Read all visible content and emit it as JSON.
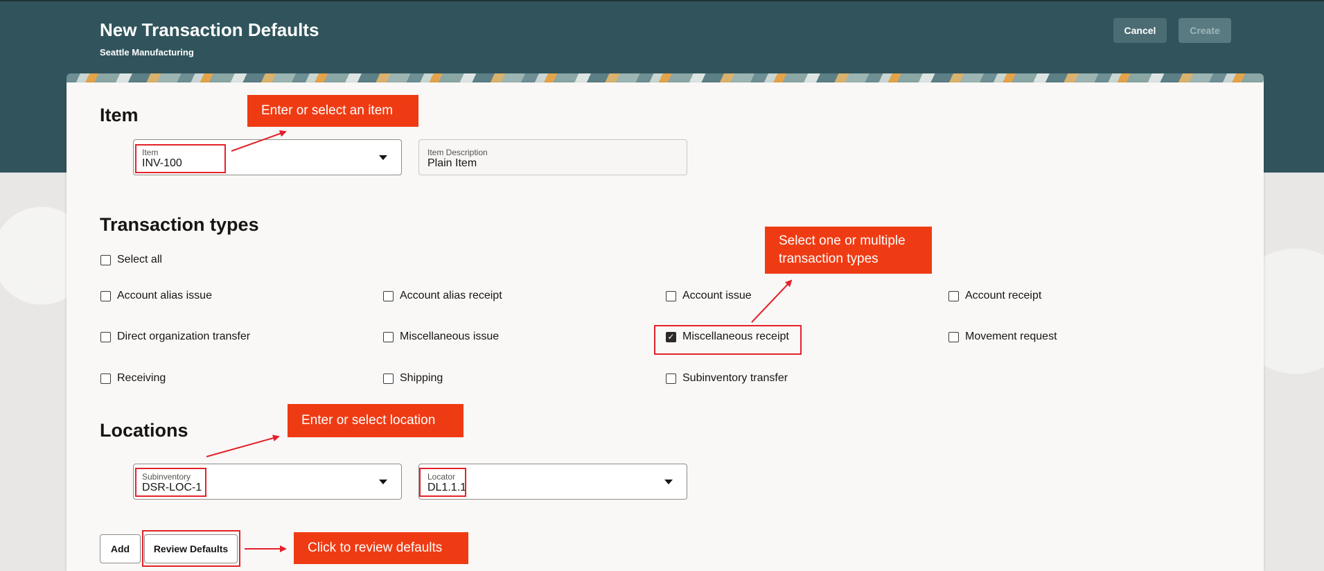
{
  "header": {
    "title": "New Transaction Defaults",
    "subtitle": "Seattle Manufacturing",
    "cancel_label": "Cancel",
    "create_label": "Create"
  },
  "item_section": {
    "title": "Item",
    "item_field": {
      "label": "Item",
      "value": "INV-100"
    },
    "description_field": {
      "label": "Item Description",
      "value": "Plain Item"
    }
  },
  "transaction_types": {
    "title": "Transaction types",
    "select_all_label": "Select all",
    "options": [
      {
        "label": "Account alias issue",
        "checked": false
      },
      {
        "label": "Account alias receipt",
        "checked": false
      },
      {
        "label": "Account issue",
        "checked": false
      },
      {
        "label": "Account receipt",
        "checked": false
      },
      {
        "label": "Direct organization transfer",
        "checked": false
      },
      {
        "label": "Miscellaneous issue",
        "checked": false
      },
      {
        "label": "Miscellaneous receipt",
        "checked": true
      },
      {
        "label": "Movement request",
        "checked": false
      },
      {
        "label": "Receiving",
        "checked": false
      },
      {
        "label": "Shipping",
        "checked": false
      },
      {
        "label": "Subinventory transfer",
        "checked": false
      }
    ]
  },
  "locations": {
    "title": "Locations",
    "subinventory_field": {
      "label": "Subinventory",
      "value": "DSR-LOC-1"
    },
    "locator_field": {
      "label": "Locator",
      "value": "DL1.1.1"
    }
  },
  "actions": {
    "add_label": "Add",
    "review_defaults_label": "Review Defaults"
  },
  "callouts": {
    "item": "Enter or select an item",
    "transaction_types": "Select one or multiple transaction types",
    "location": "Enter or select location",
    "review": "Click to review defaults"
  },
  "colors": {
    "header_bg": "#31545c",
    "callout_bg": "#ef3b13",
    "highlight_border": "#e4212a"
  }
}
